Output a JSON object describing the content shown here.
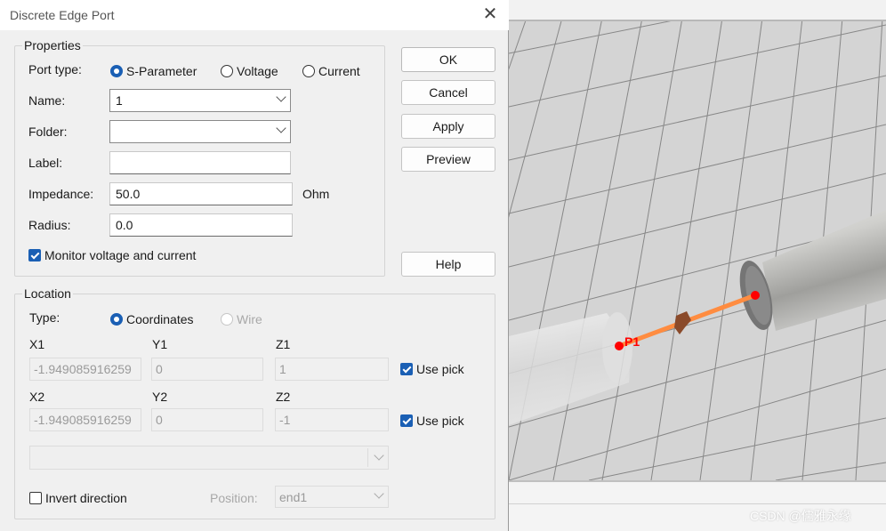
{
  "dialog": {
    "title": "Discrete Edge Port",
    "close_glyph": "✕"
  },
  "properties": {
    "legend": "Properties",
    "port_type_label": "Port type:",
    "port_types": [
      "S-Parameter",
      "Voltage",
      "Current"
    ],
    "port_type_selected": "S-Parameter",
    "name_label": "Name:",
    "name_value": "1",
    "folder_label": "Folder:",
    "folder_value": "",
    "label_label": "Label:",
    "label_value": "",
    "impedance_label": "Impedance:",
    "impedance_value": "50.0",
    "impedance_unit": "Ohm",
    "radius_label": "Radius:",
    "radius_value": "0.0",
    "monitor_label": "Monitor voltage and current",
    "monitor_checked": true
  },
  "buttons": {
    "ok": "OK",
    "cancel": "Cancel",
    "apply": "Apply",
    "preview": "Preview",
    "help": "Help"
  },
  "location": {
    "legend": "Location",
    "type_label": "Type:",
    "types": [
      "Coordinates",
      "Wire"
    ],
    "type_selected": "Coordinates",
    "x1_label": "X1",
    "y1_label": "Y1",
    "z1_label": "Z1",
    "x1_value": "-1.949085916259",
    "y1_value": "0",
    "z1_value": "1",
    "x2_label": "X2",
    "y2_label": "Y2",
    "z2_label": "Z2",
    "x2_value": "-1.949085916259",
    "y2_value": "0",
    "z2_value": "-1",
    "use_pick_label": "Use pick",
    "use_pick1_checked": true,
    "use_pick2_checked": true,
    "wire_combo_value": "",
    "invert_label": "Invert direction",
    "invert_checked": false,
    "position_label": "Position:",
    "position_value": "end1"
  },
  "viewport": {
    "port_label": "P1",
    "port_color": "#ff0000",
    "edge_color": "#ff8c40",
    "grid_color": "#6e6e6e"
  },
  "watermark": "CSDN @儒雅永缘",
  "colors": {
    "accent": "#1a5fb4"
  }
}
